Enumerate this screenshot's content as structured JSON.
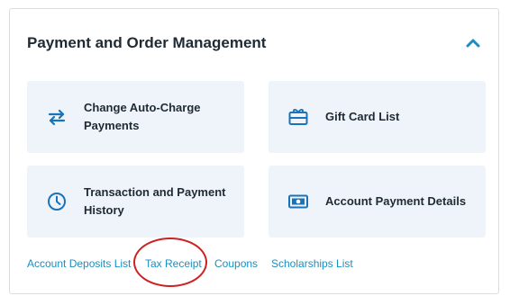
{
  "section": {
    "title": "Payment and Order Management"
  },
  "cards": [
    {
      "label": "Change Auto-Charge Payments",
      "icon": "swap-arrows-icon"
    },
    {
      "label": "Gift Card List",
      "icon": "gift-card-icon"
    },
    {
      "label": "Transaction and Payment History",
      "icon": "clock-icon"
    },
    {
      "label": "Account Payment Details",
      "icon": "money-bill-icon"
    }
  ],
  "links": [
    {
      "label": "Account Deposits List"
    },
    {
      "label": "Tax Receipt"
    },
    {
      "label": "Coupons"
    },
    {
      "label": "Scholarships List"
    }
  ],
  "colors": {
    "accent": "#1a8fbf",
    "card_background": "#eef4f9",
    "annotation": "#cc2222"
  }
}
